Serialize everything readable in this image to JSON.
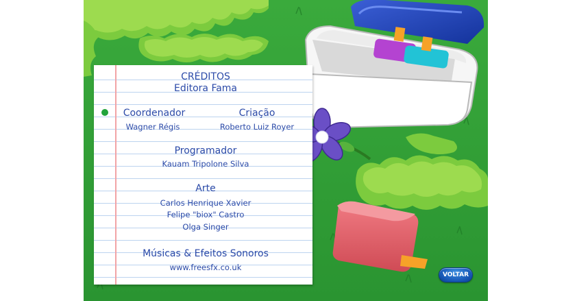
{
  "credits": {
    "title": "CRÉDITOS",
    "publisher": "Editora Fama",
    "coordinator_heading": "Coordenador",
    "coordinator_name": "Wagner Régis",
    "creation_heading": "Criação",
    "creation_name": "Roberto Luiz Royer",
    "programmer_heading": "Programador",
    "programmer_name": "Kauam Tripolone Silva",
    "art_heading": "Arte",
    "art_names": [
      "Carlos Henrique Xavier",
      "Felipe \"biox\" Castro",
      "Olga Singer"
    ],
    "music_heading": "Músicas & Efeitos Sonoros",
    "music_source": "www.freesfx.co.uk"
  },
  "buttons": {
    "back_label": "VOLTAR"
  },
  "colors": {
    "grass": "#2f9d35",
    "ink": "#2b4aa8",
    "button": "#1758b6",
    "paper_line": "#bcd3ef",
    "margin_line": "#f2a3a6"
  }
}
